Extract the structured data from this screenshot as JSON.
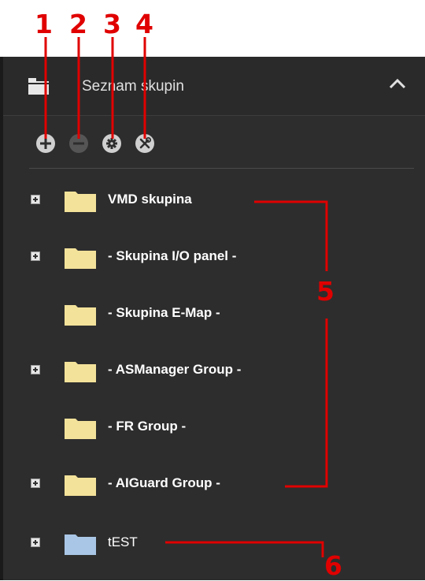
{
  "callouts": [
    "1",
    "2",
    "3",
    "4",
    "5",
    "6"
  ],
  "panel": {
    "title": "Seznam skupin",
    "toolbar": [
      {
        "name": "add-group-button",
        "icon": "plus-icon"
      },
      {
        "name": "remove-group-button",
        "icon": "minus-icon"
      },
      {
        "name": "group-settings-button",
        "icon": "gear-icon"
      },
      {
        "name": "group-tools-button",
        "icon": "wrench-screwdriver-icon"
      }
    ]
  },
  "tree": [
    {
      "label": "VMD skupina",
      "expandable": true,
      "folder_color": "#f3e29a"
    },
    {
      "label": "- Skupina I/O panel -",
      "expandable": true,
      "folder_color": "#f3e29a"
    },
    {
      "label": "- Skupina E-Map -",
      "expandable": false,
      "folder_color": "#f3e29a"
    },
    {
      "label": "- ASManager Group -",
      "expandable": true,
      "folder_color": "#f3e29a"
    },
    {
      "label": "- FR Group -",
      "expandable": false,
      "folder_color": "#f3e29a"
    },
    {
      "label": "- AIGuard Group -",
      "expandable": true,
      "folder_color": "#f3e29a"
    },
    {
      "label": "tEST",
      "expandable": true,
      "folder_color": "#a9c6e6"
    }
  ],
  "colors": {
    "panel_bg": "#2d2d2d",
    "annotation_red": "#e00000",
    "folder_yellow": "#f3e29a",
    "folder_blue": "#a9c6e6"
  }
}
